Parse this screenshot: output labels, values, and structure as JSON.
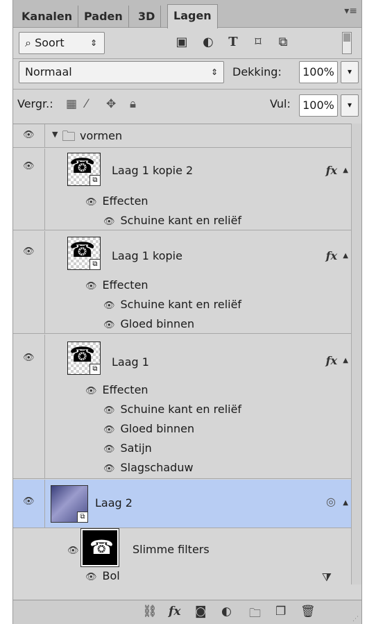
{
  "tabs": [
    {
      "label": "Kanalen",
      "active": false
    },
    {
      "label": "Paden",
      "active": false
    },
    {
      "label": "3D",
      "active": false
    },
    {
      "label": "Lagen",
      "active": true
    }
  ],
  "filter": {
    "search_glyph": "⌕",
    "kind": "Soort"
  },
  "blend": {
    "mode": "Normaal",
    "opacity_label": "Dekking:",
    "opacity": "100%"
  },
  "lock": {
    "label": "Vergr.:",
    "fill_label": "Vul:",
    "fill": "100%"
  },
  "layers": {
    "group": {
      "name": "vormen"
    },
    "l1k2": {
      "name": "Laag 1 kopie 2",
      "effects": "Effecten",
      "e1": "Schuine kant en reliëf"
    },
    "l1k": {
      "name": "Laag 1 kopie",
      "effects": "Effecten",
      "e1": "Schuine kant en reliëf",
      "e2": "Gloed binnen"
    },
    "l1": {
      "name": "Laag 1",
      "effects": "Effecten",
      "e1": "Schuine kant en reliëf",
      "e2": "Gloed binnen",
      "e3": "Satijn",
      "e4": "Slagschaduw"
    },
    "l2": {
      "name": "Laag 2",
      "smart_filters": "Slimme filters",
      "filter1": "Bol",
      "selected": true
    }
  },
  "colors": {
    "panel": "#d6d6d6",
    "selected_row": "#b8cdf3",
    "tab_bar": "#bdbdbd"
  }
}
